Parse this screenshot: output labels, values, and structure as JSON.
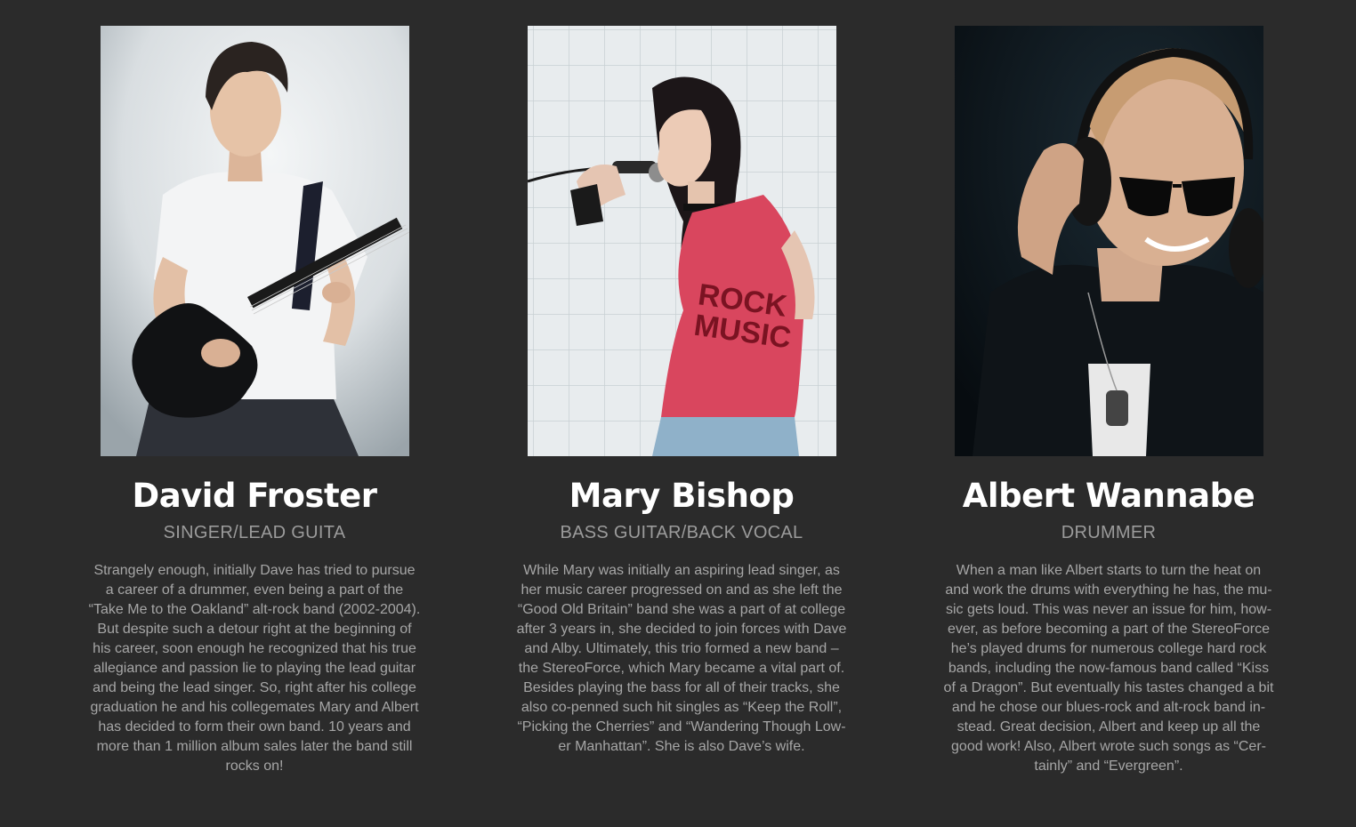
{
  "members": [
    {
      "name": "David Froster",
      "role": "SINGER/LEAD GUITA",
      "bio": "Strangely enough, initially Dave has tried to pursue\na career of a drummer, even being a part of the\n“Take Me to the Oakland” alt-rock band (2002-2004).\nBut despite such a detour right at the beginning of\nhis career, soon enough he recognized that his true\nallegiance and passion lie to playing the lead guitar\nand being the lead singer. So, right after his college\ngraduation he and his collegemates Mary and Albert\nhas decided to form their own band. 10 years and\nmore than 1 million album sales later the band still\nrocks on!"
    },
    {
      "name": "Mary Bishop",
      "role": "BASS GUITAR/BACK VOCAL",
      "bio": "While Mary was initially an aspiring lead singer, as\nher music career progressed on and as she left the\n“Good Old Britain” band she was a part of at college\nafter 3 years in, she decided to join forces with Dave\nand Alby. Ultimately, this trio formed a new band –\nthe StereoForce, which Mary became a vital part of.\nBesides playing the bass for all of their tracks, she\nalso co-penned such hit singles as “Keep the Roll”,\n“Picking the Cherries” and “Wandering Though Low-\ner Manhattan”. She is also Dave’s wife."
    },
    {
      "name": "Albert Wannabe",
      "role": "DRUMMER",
      "bio": "When a man like Albert starts to turn the heat on\nand work the drums with everything he has, the mu-\nsic gets loud. This was never an issue for him, how-\never, as before becoming a part of the StereoForce\nhe’s played drums for numerous college hard rock\nbands, including the now-famous band called “Kiss\nof a Dragon”. But eventually his tastes changed a bit\nand he chose our blues-rock and alt-rock band in-\nstead. Great decision, Albert and keep up all the\ngood work! Also, Albert wrote such songs as “Cer-\ntainly” and “Evergreen”."
    }
  ],
  "photo_text": {
    "shirt_line1": "ROCK",
    "shirt_line2": "MUSIC"
  },
  "colors": {
    "background": "#2b2b2b",
    "name": "#ffffff",
    "role": "#9b9b9b",
    "bio": "#a6a6a6"
  }
}
